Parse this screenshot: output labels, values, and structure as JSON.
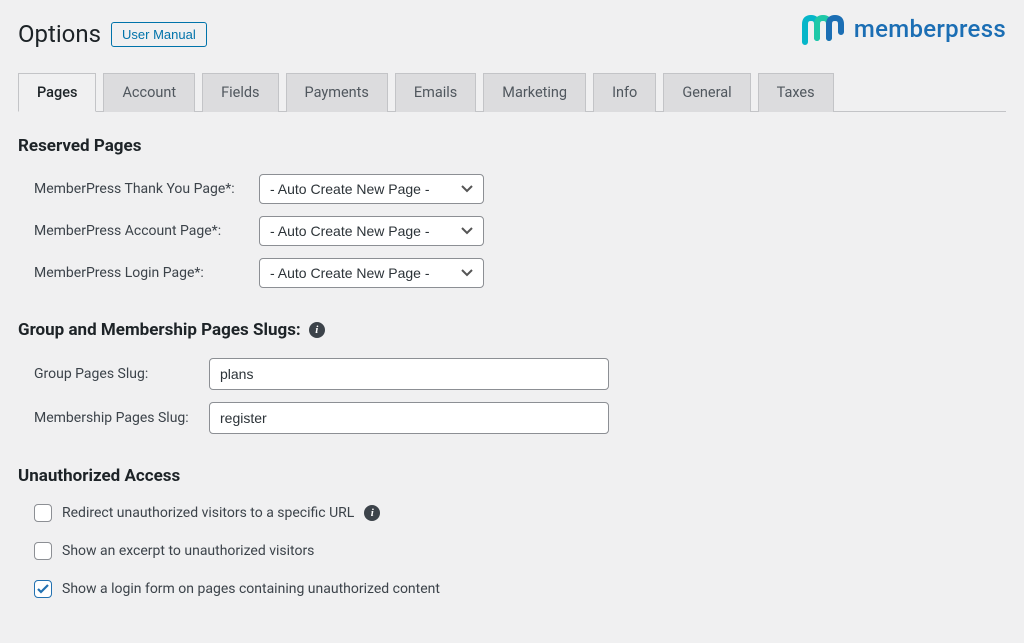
{
  "header": {
    "title": "Options",
    "manual_button": "User Manual",
    "logo_text": "memberpress"
  },
  "tabs": [
    {
      "label": "Pages",
      "active": true
    },
    {
      "label": "Account",
      "active": false
    },
    {
      "label": "Fields",
      "active": false
    },
    {
      "label": "Payments",
      "active": false
    },
    {
      "label": "Emails",
      "active": false
    },
    {
      "label": "Marketing",
      "active": false
    },
    {
      "label": "Info",
      "active": false
    },
    {
      "label": "General",
      "active": false
    },
    {
      "label": "Taxes",
      "active": false
    }
  ],
  "sections": {
    "reserved": {
      "heading": "Reserved Pages",
      "rows": [
        {
          "label": "MemberPress Thank You Page*:",
          "value": "- Auto Create New Page -"
        },
        {
          "label": "MemberPress Account Page*:",
          "value": "- Auto Create New Page -"
        },
        {
          "label": "MemberPress Login Page*:",
          "value": "- Auto Create New Page -"
        }
      ]
    },
    "slugs": {
      "heading": "Group and Membership Pages Slugs:",
      "rows": [
        {
          "label": "Group Pages Slug:",
          "value": "plans"
        },
        {
          "label": "Membership Pages Slug:",
          "value": "register"
        }
      ]
    },
    "unauth": {
      "heading": "Unauthorized Access",
      "checks": [
        {
          "label": "Redirect unauthorized visitors to a specific URL",
          "checked": false,
          "info": true
        },
        {
          "label": "Show an excerpt to unauthorized visitors",
          "checked": false,
          "info": false
        },
        {
          "label": "Show a login form on pages containing unauthorized content",
          "checked": true,
          "info": false
        }
      ]
    }
  }
}
